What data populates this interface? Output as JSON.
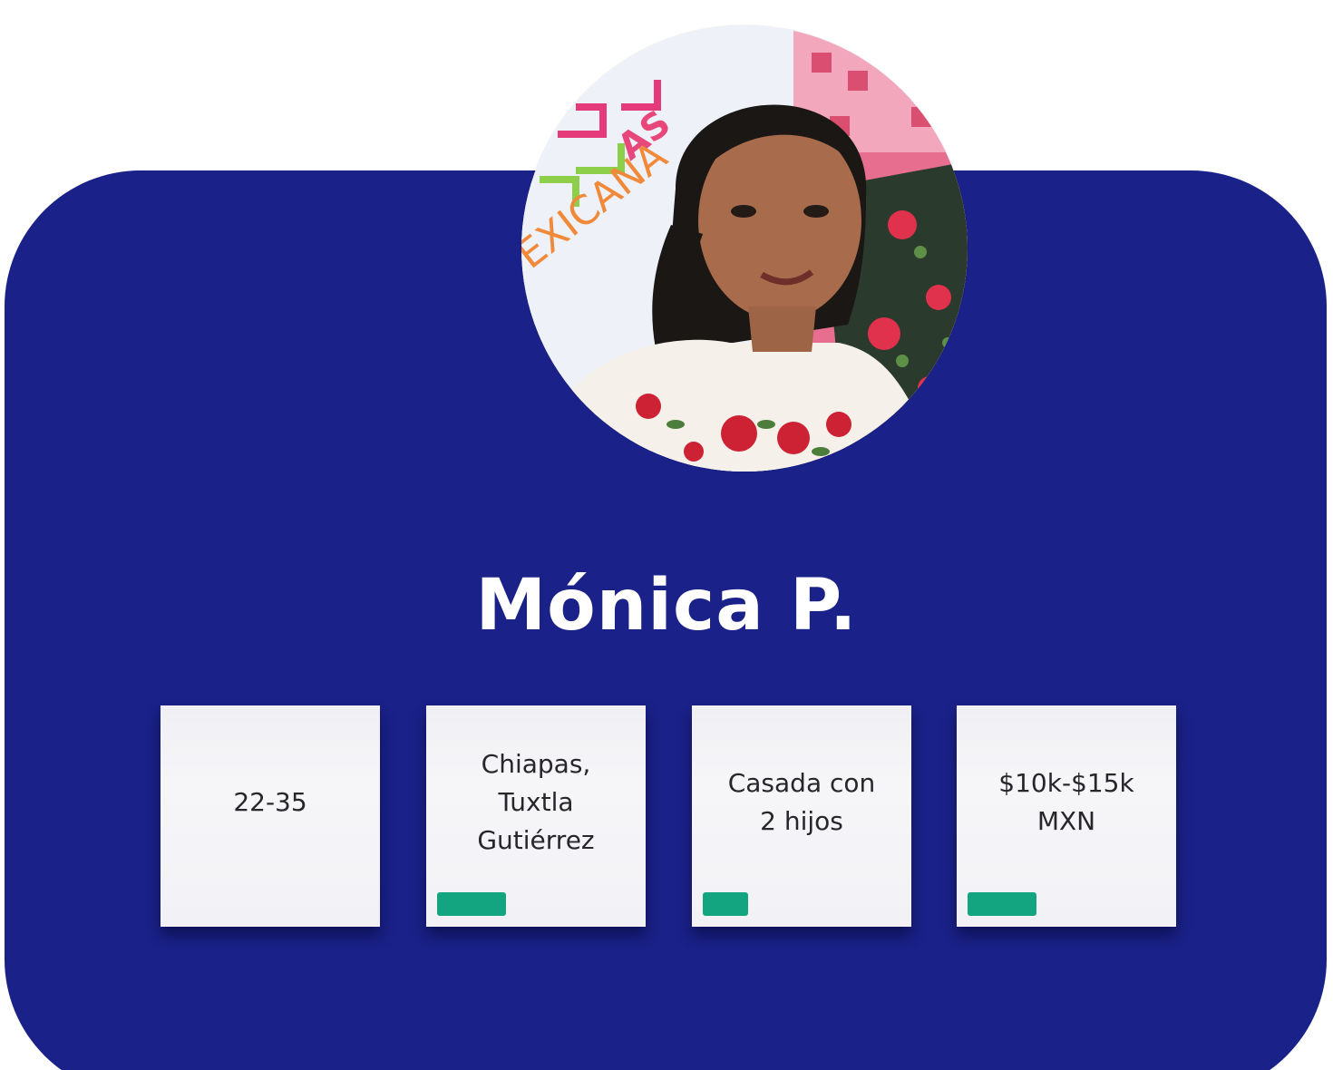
{
  "persona": {
    "name": "Mónica P.",
    "attributes": [
      {
        "text": "22-35",
        "has_tag": false
      },
      {
        "text": "Chiapas,\nTuxtla\nGutiérrez",
        "has_tag": true
      },
      {
        "text": "Casada con\n2 hijos",
        "has_tag": true
      },
      {
        "text": "$10k-$15k\nMXN",
        "has_tag": true
      }
    ]
  },
  "avatar_banner": {
    "line1": "AS",
    "line2": "EXICANA"
  },
  "colors": {
    "card_background": "#1a2188",
    "name_text": "#ffffff",
    "note_background": "#f3f3f7",
    "note_text": "#26262b",
    "tag": "#13a57f"
  }
}
